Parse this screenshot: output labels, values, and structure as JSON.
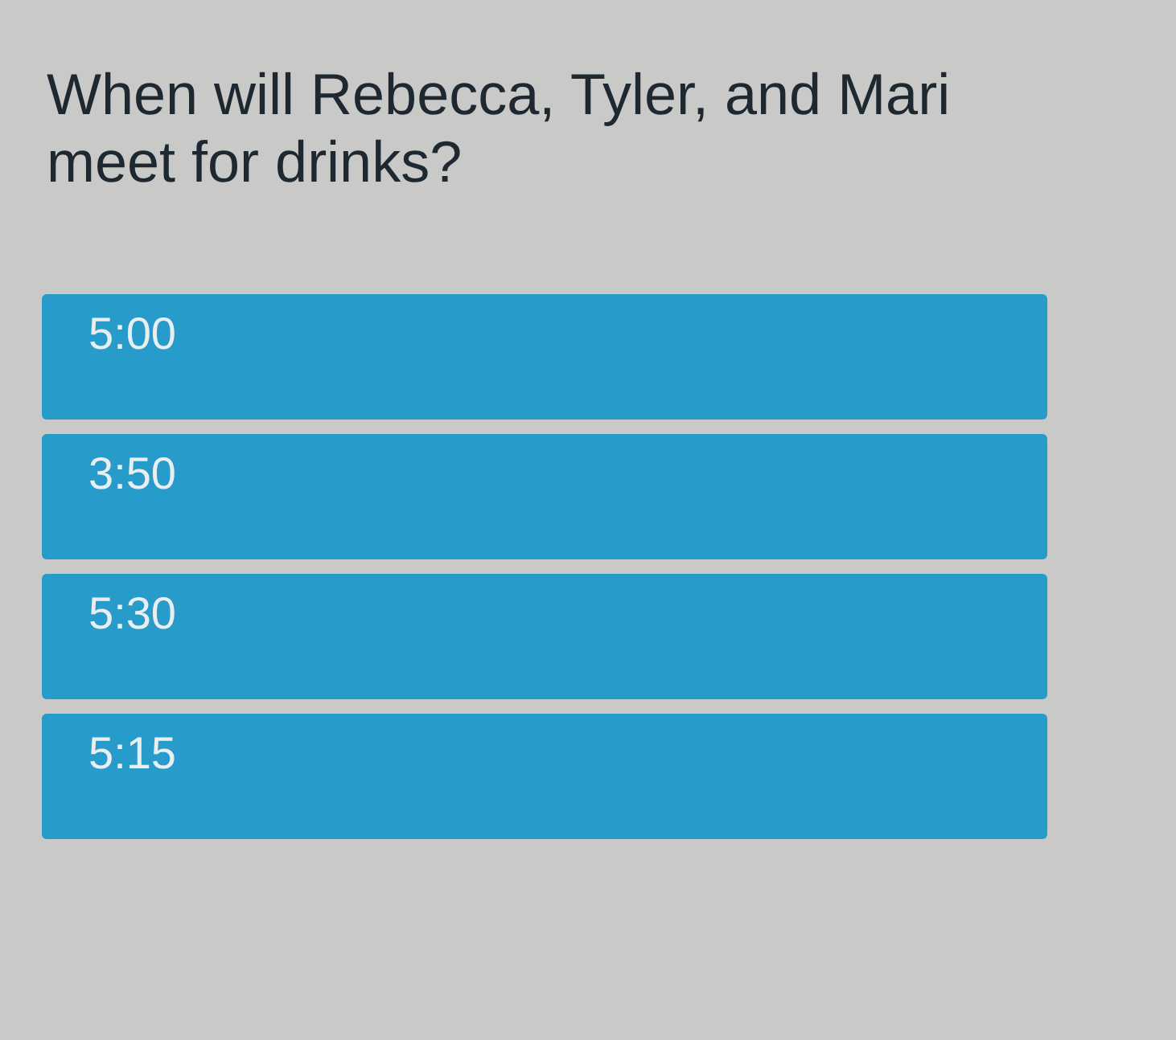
{
  "question": "When will Rebecca, Tyler, and Mari meet for drinks?",
  "options": [
    {
      "label": "5:00"
    },
    {
      "label": "3:50"
    },
    {
      "label": "5:30"
    },
    {
      "label": "5:15"
    }
  ]
}
